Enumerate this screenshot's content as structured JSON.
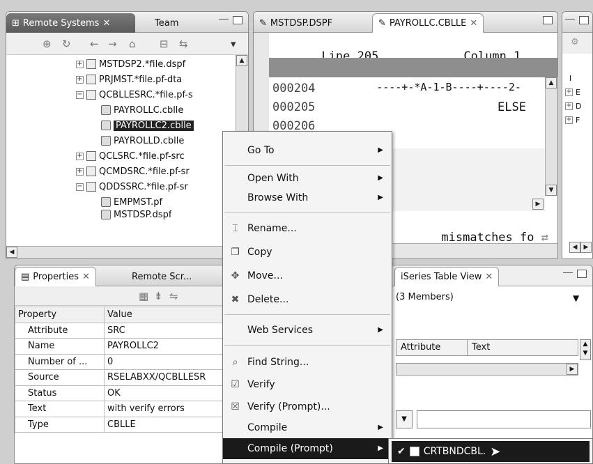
{
  "remote_view": {
    "tabs": [
      "Remote Systems",
      "Team"
    ],
    "tree": [
      {
        "label": "MSTDSP2.*file.dspf",
        "expander": "+"
      },
      {
        "label": "PRJMST.*file.pf-dta",
        "expander": "+"
      },
      {
        "label": "QCBLLESRC.*file.pf-s",
        "expander": "−"
      },
      {
        "label": "PAYROLLC.cblle",
        "expander": ""
      },
      {
        "label": "PAYROLLC2.cblle",
        "expander": "",
        "selected": true
      },
      {
        "label": "PAYROLLD.cblle",
        "expander": ""
      },
      {
        "label": "QCLSRC.*file.pf-src",
        "expander": "+"
      },
      {
        "label": "QCMDSRC.*file.pf-sr",
        "expander": "+"
      },
      {
        "label": "QDDSSRC.*file.pf-sr",
        "expander": "−"
      },
      {
        "label": "EMPMST.pf",
        "expander": ""
      },
      {
        "label": "MSTDSP.dspf",
        "expander": ""
      }
    ]
  },
  "editor": {
    "tabs": [
      "MSTDSP.DSPF",
      "PAYROLLC.CBLLE"
    ],
    "line_label": "Line 205",
    "column_label": "Column 1",
    "ruler": "----+-*A-1-B----+----2-",
    "lines": [
      {
        "num": "000204",
        "text": ""
      },
      {
        "num": "000205",
        "text": "ELSE"
      },
      {
        "num": "000206",
        "text": ""
      }
    ],
    "message": "mismatches fo"
  },
  "outline_view": {
    "items": [
      "I",
      "E",
      "D",
      "F"
    ]
  },
  "properties": {
    "tabs": [
      "Properties",
      "Remote Scr..."
    ],
    "headers": [
      "Property",
      "Value"
    ],
    "rows": [
      {
        "property": "Attribute",
        "value": "SRC"
      },
      {
        "property": "Name",
        "value": "PAYROLLC2"
      },
      {
        "property": "Number of ...",
        "value": "0"
      },
      {
        "property": "Source",
        "value": "RSELABXX/QCBLLESR"
      },
      {
        "property": "Status",
        "value": "OK"
      },
      {
        "property": "Text",
        "value": "with verify errors"
      },
      {
        "property": "Type",
        "value": "CBLLE"
      }
    ]
  },
  "table_view": {
    "tab": "iSeries Table View",
    "members": "(3 Members)",
    "columns": [
      "Attribute",
      "Text"
    ]
  },
  "context_menu": {
    "items": [
      {
        "label": "Go To",
        "submenu": true,
        "icon": ""
      },
      {
        "label": "Open With",
        "submenu": true,
        "icon": ""
      },
      {
        "label": "Browse With",
        "submenu": true,
        "icon": ""
      },
      {
        "label": "Rename...",
        "submenu": false,
        "icon": "rename-icon"
      },
      {
        "label": "Copy",
        "submenu": false,
        "icon": "copy-icon"
      },
      {
        "label": "Move...",
        "submenu": false,
        "icon": "move-icon"
      },
      {
        "label": "Delete...",
        "submenu": false,
        "icon": "delete-icon"
      },
      {
        "label": "Web Services",
        "submenu": true,
        "icon": ""
      },
      {
        "label": "Find String...",
        "submenu": false,
        "icon": "find-icon"
      },
      {
        "label": "Verify",
        "submenu": false,
        "icon": "verify-icon"
      },
      {
        "label": "Verify (Prompt)...",
        "submenu": false,
        "icon": "verify-prompt-icon"
      },
      {
        "label": "Compile",
        "submenu": true,
        "icon": ""
      },
      {
        "label": "Compile (Prompt)",
        "submenu": true,
        "icon": "",
        "highlighted": true
      }
    ],
    "submenu_item": "CRTBNDCBL."
  }
}
